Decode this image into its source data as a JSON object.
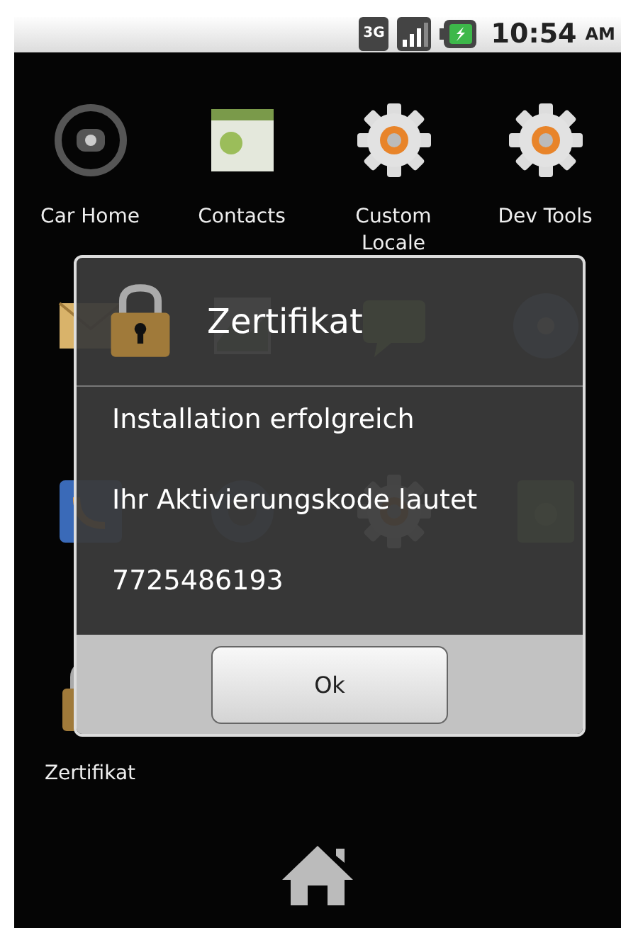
{
  "status_bar": {
    "network": "3G",
    "time": "10:54",
    "period": "AM"
  },
  "apps": [
    {
      "label": "Car Home",
      "kind": "wheel"
    },
    {
      "label": "Contacts",
      "kind": "contacts"
    },
    {
      "label": "Custom Locale",
      "kind": "gear"
    },
    {
      "label": "Dev Tools",
      "kind": "gear"
    },
    {
      "kind": "email"
    },
    {
      "kind": "gallery"
    },
    {
      "kind": "messaging"
    },
    {
      "kind": "music"
    },
    {
      "kind": "phone"
    },
    {
      "kind": "dial"
    },
    {
      "kind": "gear"
    },
    {
      "kind": "recorder"
    },
    {
      "label": "Zertifikat",
      "kind": "lock"
    }
  ],
  "dialog": {
    "title": "Zertifikat",
    "lines": [
      "Installation erfolgreich",
      "Ihr Aktivierungskode lautet",
      "7725486193"
    ],
    "button": "Ok"
  }
}
